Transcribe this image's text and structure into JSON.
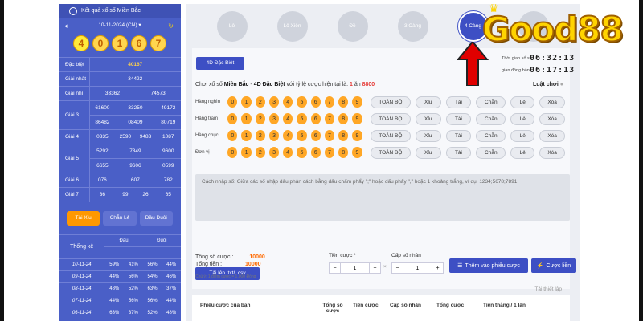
{
  "sidebar": {
    "title": "Kết quả xổ số Miền Bắc",
    "date": "10-11-2024 (CN) ▾",
    "balls": [
      "4",
      "0",
      "1",
      "6",
      "7"
    ],
    "prizes": [
      {
        "label": "Đặc biệt",
        "values": [
          "40167"
        ],
        "hl": true
      },
      {
        "label": "Giải nhất",
        "values": [
          "34422"
        ]
      },
      {
        "label": "Giải nhì",
        "values": [
          "33362",
          "74573"
        ]
      },
      {
        "label": "Giải 3",
        "values": [
          "61600",
          "33250",
          "49172",
          "86482",
          "08409",
          "80719"
        ]
      },
      {
        "label": "Giải 4",
        "values": [
          "0335",
          "2590",
          "9483",
          "1087"
        ]
      },
      {
        "label": "Giải 5",
        "values": [
          "5292",
          "7349",
          "9600",
          "6655",
          "9606",
          "0599"
        ]
      },
      {
        "label": "Giải 6",
        "values": [
          "076",
          "607",
          "782"
        ]
      },
      {
        "label": "Giải 7",
        "values": [
          "36",
          "99",
          "26",
          "65"
        ]
      }
    ],
    "tabs": [
      "Tài Xỉu",
      "Chẵn Lẻ",
      "Đầu Đuôi"
    ],
    "stats_header": {
      "title": "Thống kê",
      "dau": "Đầu",
      "duoi": "Đuôi"
    },
    "stats": [
      [
        "10-11-24",
        "59%",
        "41%",
        "56%",
        "44%"
      ],
      [
        "09-11-24",
        "44%",
        "56%",
        "54%",
        "46%"
      ],
      [
        "08-11-24",
        "48%",
        "52%",
        "63%",
        "37%"
      ],
      [
        "07-11-24",
        "44%",
        "56%",
        "56%",
        "44%"
      ],
      [
        "06-11-24",
        "63%",
        "37%",
        "52%",
        "48%"
      ]
    ]
  },
  "nav": [
    "Lô",
    "Lô Xiên",
    "Đề",
    "3 Càng",
    "4 Càng"
  ],
  "card": {
    "tag": "4D Đặc Biệt",
    "time_left_label": "Thời gian xổ số:",
    "time_left": "06:32:13",
    "stop_label": "gian đóng bàn:",
    "stop_time": "06:17:13",
    "rate_prefix": "Chơi xổ số ",
    "rate_bold1": "Miền Bắc",
    "rate_mid": " - ",
    "rate_bold2": "4D Đặc Biệt",
    "rate_suffix": " với tỷ lệ cược hiện tại là: ",
    "rate_r1": "1",
    "rate_an": " ăn ",
    "rate_r2": "8800",
    "rules": "Luật chơi",
    "rows": [
      {
        "label": "Hàng nghìn"
      },
      {
        "label": "Hàng trăm"
      },
      {
        "label": "Hàng chục"
      },
      {
        "label": "Đơn vị"
      }
    ],
    "digits": [
      "0",
      "1",
      "2",
      "3",
      "4",
      "5",
      "6",
      "7",
      "8",
      "9"
    ],
    "options": [
      "TOÀN BỘ",
      "Xỉu",
      "Tài",
      "Chẵn",
      "Lẻ",
      "Xóa"
    ],
    "textarea": "Cách nhập số: Giữa các số nhập dấu phân cách bằng dấu chấm phẩy \";\" hoặc dấu phẩy \",\" hoặc 1 khoảng trắng, ví dụ: 1234;5678;7891",
    "upload": "Tải lên .txt/ .csv",
    "template": "Tải thiết lập"
  },
  "bottom": {
    "total_bet_label": "Tổng số cược :",
    "total_bet": "10000",
    "total_money_label": "Tổng tiền :",
    "total_money": "10000",
    "note": "Chú ý: 1 điểm cược = 1.000 Đồng",
    "stake_label": "Tiền cược *",
    "stake": "1",
    "mult_label": "Cấp số nhân",
    "mult": "1",
    "add_btn": "Thêm vào phiếu cược",
    "bet_btn": "Cược liền"
  },
  "table_header": [
    "Phiếu cược của bạn",
    "Tổng số cược",
    "Tiền cược",
    "Cấp số nhân",
    "Tổng cược",
    "Tiền thắng / 1 lần"
  ],
  "overlay": {
    "brand": "Good88"
  }
}
